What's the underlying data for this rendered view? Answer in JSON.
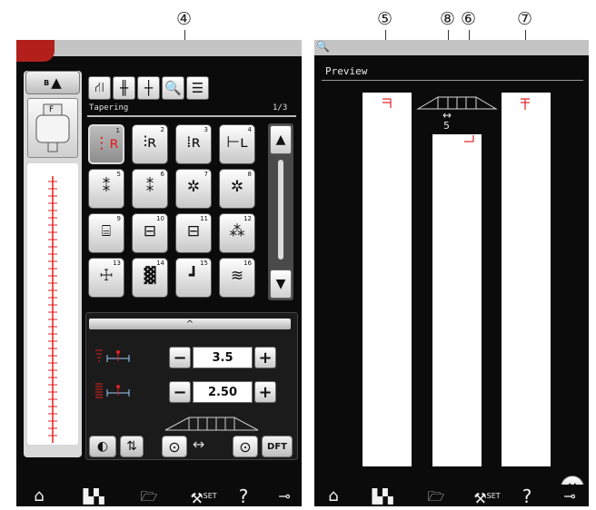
{
  "callouts": {
    "c4": "④",
    "c5": "⑤",
    "c6": "⑥",
    "c7": "⑦",
    "c8": "⑧"
  },
  "left_screen": {
    "header": {
      "foot_label": "B",
      "presser_foot_letter": "F"
    },
    "toolbar": [
      {
        "name": "stitch-settings-icon",
        "glyph": "⛙"
      },
      {
        "name": "foot-height-icon",
        "glyph": "╫"
      },
      {
        "name": "needle-position-icon",
        "glyph": "┼"
      },
      {
        "name": "preview-magnifier-icon",
        "glyph": "🔍"
      },
      {
        "name": "memo-icon",
        "glyph": "☰"
      }
    ],
    "category_label": "Tapering",
    "page_indicator": "1/3",
    "stitches": [
      {
        "num": "1",
        "glyph": "⋮ʀ",
        "selected": true
      },
      {
        "num": "2",
        "glyph": "⫶ʀ"
      },
      {
        "num": "3",
        "glyph": "⁞ʀ"
      },
      {
        "num": "4",
        "glyph": "⊢ʟ"
      },
      {
        "num": "5",
        "glyph": "⁑"
      },
      {
        "num": "6",
        "glyph": "⁑"
      },
      {
        "num": "7",
        "glyph": "✲"
      },
      {
        "num": "8",
        "glyph": "✲"
      },
      {
        "num": "9",
        "glyph": "⌸"
      },
      {
        "num": "10",
        "glyph": "⊟"
      },
      {
        "num": "11",
        "glyph": "⊟"
      },
      {
        "num": "12",
        "glyph": "⁂"
      },
      {
        "num": "13",
        "glyph": "☩"
      },
      {
        "num": "14",
        "glyph": "▓"
      },
      {
        "num": "15",
        "glyph": "┛"
      },
      {
        "num": "16",
        "glyph": "≋"
      }
    ],
    "scroll_up": "▲",
    "scroll_down": "▼",
    "collapse_glyph": "^",
    "width_setting": {
      "minus": "−",
      "value": "3.5",
      "plus": "+"
    },
    "length_setting": {
      "minus": "−",
      "value": "2.50",
      "plus": "+"
    },
    "dft_label": "DFT",
    "mirror_glyph": "◐",
    "flip_glyph": "⇅",
    "start_glyph": "⊙",
    "end_glyph": "⊙",
    "arrow_glyph": "↔"
  },
  "right_screen": {
    "magnifier_glyph": "🔍",
    "title": "Preview",
    "length_value": "5",
    "close_glyph": "×"
  },
  "nav": {
    "home": "⌂",
    "set_label": "SET",
    "help": "?"
  },
  "colors": {
    "accent_red": "#e02020",
    "tab_red": "#b3201b",
    "screen_bg": "#0b0b0b"
  }
}
